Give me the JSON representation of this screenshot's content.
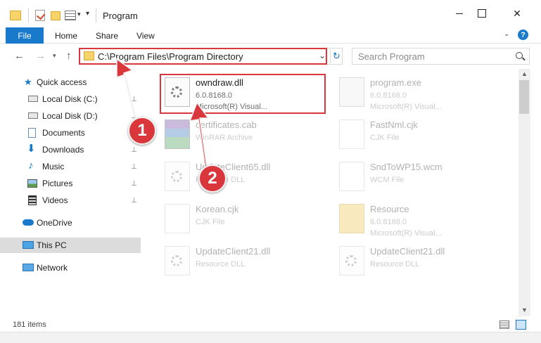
{
  "window": {
    "title": "Program",
    "minimize_icon": "minimize-icon",
    "maximize_icon": "maximize-icon",
    "close_glyph": "✕"
  },
  "quick_access_toolbar": {
    "dropdown_glyph": "▾",
    "customize_glyph": "▾"
  },
  "ribbon": {
    "tabs": [
      "File",
      "Home",
      "Share",
      "View"
    ],
    "expand_glyph": "⌄",
    "help_glyph": "?"
  },
  "navigation": {
    "back_glyph": "←",
    "forward_glyph": "→",
    "recent_glyph": "▾",
    "up_glyph": "↑",
    "address": "C:\\Program Files\\Program Directory",
    "address_drop_glyph": "⌄",
    "refresh_glyph": "↻",
    "search_placeholder": "Search Program"
  },
  "sidebar": {
    "items": [
      {
        "label": "Quick access",
        "icon": "star-icon",
        "pinned": false
      },
      {
        "label": "Local Disk (C:)",
        "icon": "drive-icon",
        "pinned": true
      },
      {
        "label": "Local Disk (D:)",
        "icon": "drive-icon",
        "pinned": true
      },
      {
        "label": "Documents",
        "icon": "documents-icon",
        "pinned": true
      },
      {
        "label": "Downloads",
        "icon": "download-icon",
        "pinned": true
      },
      {
        "label": "Music",
        "icon": "music-icon",
        "pinned": true
      },
      {
        "label": "Pictures",
        "icon": "pictures-icon",
        "pinned": true
      },
      {
        "label": "Videos",
        "icon": "videos-icon",
        "pinned": true
      },
      {
        "label": "OneDrive",
        "icon": "cloud-icon",
        "pinned": false
      },
      {
        "label": "This PC",
        "icon": "computer-icon",
        "pinned": false,
        "selected": true
      },
      {
        "label": "Network",
        "icon": "network-icon",
        "pinned": false
      }
    ],
    "pin_glyph": "📌"
  },
  "files": [
    {
      "name": "owndraw.dll",
      "line2": "6.0.8168.0",
      "line3": "Microsoft(R) Visual...",
      "icon": "dll-gear-icon",
      "highlighted": true
    },
    {
      "name": "program.exe",
      "line2": "6.0.8168.0",
      "line3": "Microsoft(R) Visual...",
      "icon": "exe-icon"
    },
    {
      "name": "certificates.cab",
      "line2": "WinRAR Archive",
      "line3": "",
      "icon": "archive-icon"
    },
    {
      "name": "FastNml.cjk",
      "line2": "CJK File",
      "line3": "",
      "icon": "file-icon"
    },
    {
      "name": "UpdateClient65.dll",
      "line2": "Resource DLL",
      "line3": "",
      "icon": "dll-gear-icon"
    },
    {
      "name": "SndToWP15.wcm",
      "line2": "WCM File",
      "line3": "",
      "icon": "file-icon"
    },
    {
      "name": "Korean.cjk",
      "line2": "CJK File",
      "line3": "",
      "icon": "file-icon"
    },
    {
      "name": "Resource",
      "line2": "6.0.8168.0",
      "line3": "Microsoft(R) Visual...",
      "icon": "folder-icon"
    },
    {
      "name": "UpdateClient21.dll",
      "line2": "Resource DLL",
      "line3": "",
      "icon": "dll-gear-icon"
    },
    {
      "name": "UpdateClient21.dll",
      "line2": "Resource DLL",
      "line3": "",
      "icon": "dll-gear-icon"
    }
  ],
  "status": {
    "item_count": "181 items"
  },
  "annotations": [
    {
      "number": "1",
      "color": "#d9373c"
    },
    {
      "number": "2",
      "color": "#d9373c"
    }
  ],
  "colors": {
    "accent": "#1979ca",
    "highlight": "#d9373c",
    "selection": "#dcdcdc"
  }
}
